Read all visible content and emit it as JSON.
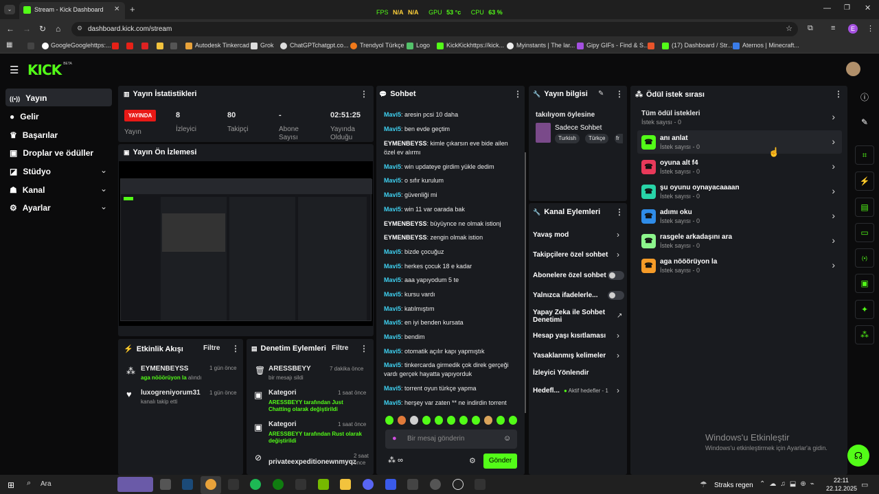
{
  "browser": {
    "tab_title": "Stream - Kick Dashboard",
    "url": "dashboard.kick.com/stream",
    "overlay": {
      "fps_label": "FPS",
      "fps": "N/A",
      "fps2": "N/A",
      "gpu_label": "GPU",
      "gpu": "53 °c",
      "cpu_label": "CPU",
      "cpu": "63 %"
    },
    "bookmarks": [
      "GoogleGooglehttps:...",
      "Autodesk Tinkercad",
      "Grok",
      "ChatGPTchatgpt.co...",
      "Trendyol Türkçe",
      "Logo",
      "KickKickhttps://kick...",
      "Myinstants | The lar...",
      "Gipy GIFs - Find & S...",
      "(17) Dashboard / Str...",
      "Aternos | Minecraft..."
    ],
    "profile_letter": "E"
  },
  "header": {
    "logo": "KICK",
    "logo_beta": "BETA"
  },
  "sidebar": {
    "items": [
      {
        "label": "Yayın",
        "icon": "broadcast-icon"
      },
      {
        "label": "Gelir",
        "icon": "coin-icon"
      },
      {
        "label": "Başarılar",
        "icon": "trophy-icon"
      },
      {
        "label": "Droplar ve ödüller",
        "icon": "gift-icon"
      },
      {
        "label": "Stüdyo",
        "icon": "studio-icon"
      },
      {
        "label": "Kanal",
        "icon": "channel-icon"
      },
      {
        "label": "Ayarlar",
        "icon": "settings-icon"
      }
    ]
  },
  "stats": {
    "title": "Yayın İstatistikleri",
    "live_badge": "YAYINDA",
    "items": [
      {
        "value": "",
        "label": "Yayın"
      },
      {
        "value": "8",
        "label": "İzleyici"
      },
      {
        "value": "80",
        "label": "Takipçi"
      },
      {
        "value": "-",
        "label": "Abone Sayısı"
      },
      {
        "value": "02:51:25",
        "label": "Yayında Olduğu"
      }
    ]
  },
  "preview": {
    "title": "Yayın Ön İzlemesi"
  },
  "activity": {
    "title": "Etkinlik Akışı",
    "filter": "Filtre",
    "items": [
      {
        "user": "EYMENBEYSS",
        "time": "1 gün önce",
        "detail_green": "aga nööörüyon la",
        "detail": " alındı"
      },
      {
        "user": "luxogreniyorum31",
        "time": "1 gün önce",
        "detail_green": "",
        "detail": "kanalı takip etti"
      }
    ]
  },
  "moderation": {
    "title": "Denetim Eylemleri",
    "filter": "Filtre",
    "items": [
      {
        "title": "ARESSBEYY",
        "time": "7 dakika önce",
        "l1": "bir mesajı sildi",
        "l2": ""
      },
      {
        "title": "Kategori",
        "time": "1 saat önce",
        "l1": "ARESSBEYY tarafından Just",
        "l2": "Chatting olarak değiştirildi"
      },
      {
        "title": "Kategori",
        "time": "1 saat önce",
        "l1": "ARESSBEYY tarafından Rust olarak",
        "l2": "değiştirildi"
      },
      {
        "title": "privateexpeditionewnmyqz",
        "time": "2 saat önce",
        "l1": "",
        "l2": ""
      }
    ]
  },
  "chat": {
    "title": "Sohbet",
    "messages": [
      {
        "user": "Mavi5",
        "text": ": aresin pcsi 10 daha"
      },
      {
        "user": "Mavi5",
        "text": ": ben evde geçtim"
      },
      {
        "user": "EYMENBEYSS",
        "text": ": kimle çıkarsın eve bide ailen özel ev alırmı"
      },
      {
        "user": "Mavi5",
        "text": ": win updateye girdim yükle dedim"
      },
      {
        "user": "Mavi5",
        "text": ": o sıfır kurulum"
      },
      {
        "user": "Mavi5",
        "text": ": güvenliği mi"
      },
      {
        "user": "Mavi5",
        "text": ": win 11 var oarada bak"
      },
      {
        "user": "EYMENBEYSS",
        "text": ": büyüynce ne olmak istionj"
      },
      {
        "user": "EYMENBEYSS",
        "text": ": zengin olmak istion"
      },
      {
        "user": "Mavi5",
        "text": ": bizde çocuğuz"
      },
      {
        "user": "Mavi5",
        "text": ": herkes çocuk 18 e kadar"
      },
      {
        "user": "Mavi5",
        "text": ": aaa yapıyodum 5 te"
      },
      {
        "user": "Mavi5",
        "text": ": kursu vardı"
      },
      {
        "user": "Mavi5",
        "text": ": katılmıştım"
      },
      {
        "user": "Mavi5",
        "text": ": en iyi benden kursata"
      },
      {
        "user": "Mavi5",
        "text": ": bendim"
      },
      {
        "user": "Mavi5",
        "text": ": otomatik açılır kapı yapmıştık"
      },
      {
        "user": "Mavi5",
        "text": ": tinkercarda girmedik çok direk gerçeği vardı gerçek hayatta yapıyorduk"
      },
      {
        "user": "Mavi5",
        "text": ": torrent oyun türkçe yapma"
      },
      {
        "user": "Mavi5",
        "text": ": herşey var zaten ** ne indirdin torrent"
      }
    ],
    "input_placeholder": "Bir mesaj gönderin",
    "points": "∞",
    "send": "Gönder"
  },
  "streaminfo": {
    "title": "Yayın bilgisi",
    "stream_title": "takılıyom öylesine",
    "category": "Sadece Sohbet",
    "tags": [
      "Turkish",
      "Türkçe",
      "fr"
    ]
  },
  "channel_actions": {
    "title": "Kanal Eylemleri",
    "rows": [
      {
        "label": "Yavaş mod",
        "type": "chevron"
      },
      {
        "label": "Takipçilere özel sohbet",
        "type": "chevron"
      },
      {
        "label": "Abonelere özel sohbet",
        "type": "toggle"
      },
      {
        "label": "Yalnızca ifadelerle...",
        "type": "toggle"
      },
      {
        "label": "Yapay Zeka ile Sohbet Denetimi",
        "type": "external"
      },
      {
        "label": "Hesap yaşı kısıtlaması",
        "type": "chevron"
      },
      {
        "label": "Yasaklanmış kelimeler",
        "type": "chevron"
      },
      {
        "label": "İzleyici Yönlendir",
        "type": "none"
      },
      {
        "label": "Hedefl...",
        "type": "chevron",
        "extra": "Aktif hedefler - 1"
      }
    ]
  },
  "rewards": {
    "title": "Ödül istek sırası",
    "all_title": "Tüm ödül istekleri",
    "all_count": "İstek sayısı - 0",
    "items": [
      {
        "title": "anı anlat",
        "count": "İstek sayısı - 0",
        "color": "#53fc18"
      },
      {
        "title": "oyuna alt f4",
        "count": "İstek sayısı - 0",
        "color": "#e8395a"
      },
      {
        "title": "şu oyunu oynayacaaaan",
        "count": "İstek sayısı - 0",
        "color": "#28d4a8"
      },
      {
        "title": "adımı oku",
        "count": "İstek sayısı - 0",
        "color": "#2f8ce8"
      },
      {
        "title": "rasgele arkadaşını ara",
        "count": "İstek sayısı - 0",
        "color": "#8cf58c"
      },
      {
        "title": "aga nööörüyon la",
        "count": "İstek sayısı - 0",
        "color": "#f59b28"
      }
    ]
  },
  "watermark": {
    "line1": "Windows'u Etkinleştir",
    "line2": "Windows'u etkinleştirmek için Ayarlar'a gidin."
  },
  "taskbar": {
    "search": "Ara",
    "weather": "Straks regen",
    "time": "22:11",
    "date": "22.12.2025"
  },
  "colors": {
    "accent": "#53fc18",
    "panel": "#191b1f",
    "live": "#e91916",
    "username": "#3fd0f0"
  }
}
